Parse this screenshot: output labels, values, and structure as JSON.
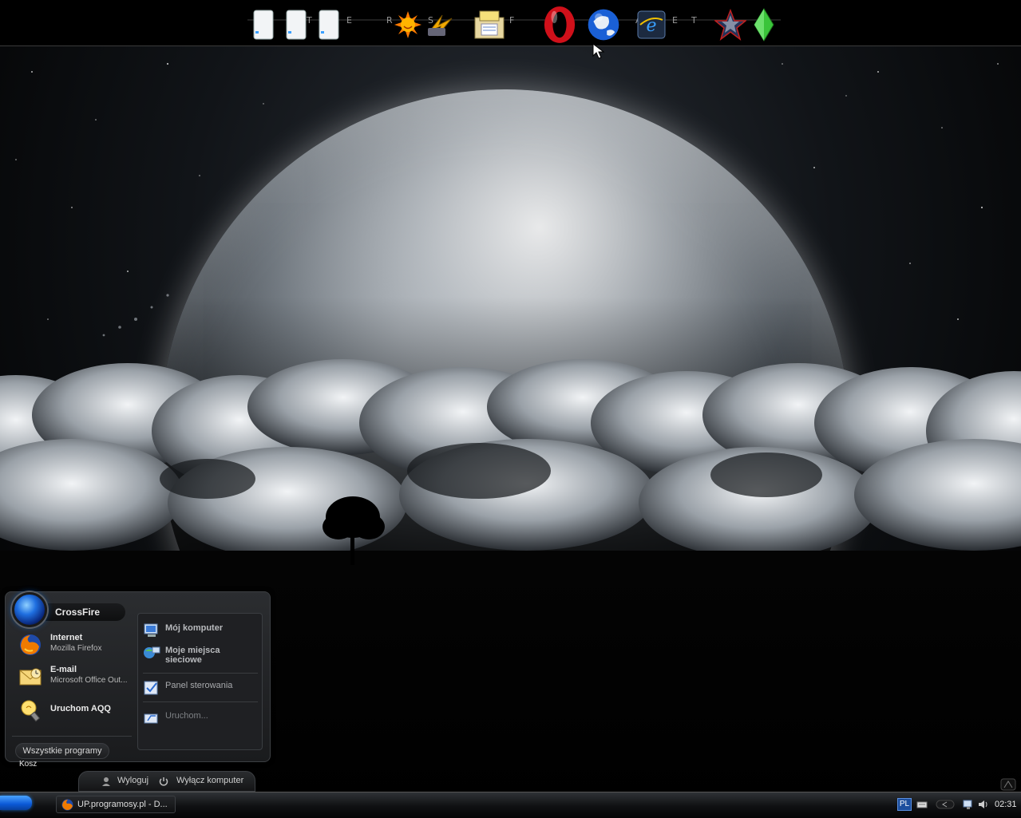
{
  "dock": {
    "letters": [
      "T",
      "E",
      "R",
      "S",
      "F",
      "A",
      "E",
      "T"
    ],
    "icons": [
      "drive-icon-1",
      "drive-icon-2",
      "drive-icon-3",
      "sun-app-icon",
      "winamp-icon",
      "notepad-folder-icon",
      "opera-icon",
      "globe-icon",
      "internet-explorer-icon",
      "star-icon",
      "sims-plumbob-icon"
    ]
  },
  "start_menu": {
    "user_name": "CrossFire",
    "pinned": [
      {
        "title": "Internet",
        "subtitle": "Mozilla Firefox",
        "icon": "firefox-icon"
      },
      {
        "title": "E-mail",
        "subtitle": "Microsoft Office Out...",
        "icon": "outlook-icon"
      },
      {
        "title": "Uruchom AQQ",
        "subtitle": "",
        "icon": "aqq-bulb-icon"
      }
    ],
    "all_programs": "Wszystkie programy",
    "places": [
      {
        "label": "Mój komputer",
        "icon": "my-computer-icon"
      },
      {
        "label": "Moje miejsca sieciowe",
        "icon": "network-places-icon"
      },
      {
        "label": "Panel sterowania",
        "icon": "control-panel-icon"
      },
      {
        "label": "Uruchom...",
        "icon": "run-icon"
      }
    ]
  },
  "logoff_bar": {
    "logoff": "Wyloguj",
    "shutdown": "Wyłącz komputer"
  },
  "desktop": {
    "recycle_bin_label": "Kosz"
  },
  "taskbar": {
    "task": {
      "label": "UP.programosy.pl - D...",
      "icon": "firefox-icon"
    },
    "tray": {
      "language": "PL",
      "clock": "02:31"
    }
  },
  "colors": {
    "accent_blue": "#1f6fe0",
    "start_orb": "#0b58d6",
    "panel_bg": "#1f2023"
  }
}
